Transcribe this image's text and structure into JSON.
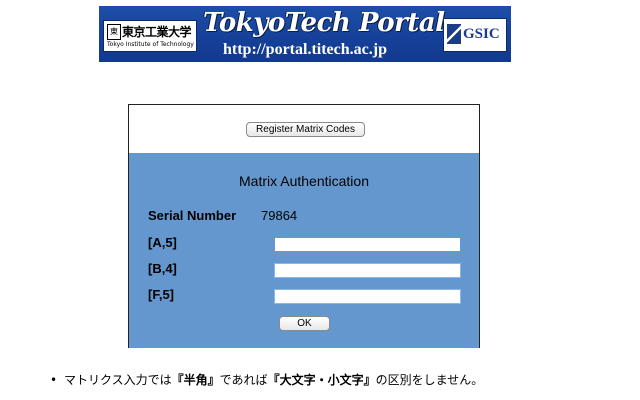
{
  "banner": {
    "logo_jp": "東京工業大学",
    "logo_en": "Tokyo Institute of Technology",
    "title": "TokyoTech Portal",
    "url": "http://portal.titech.ac.jp",
    "gsic": "GSIC"
  },
  "panel": {
    "register_button": "Register Matrix Codes",
    "title": "Matrix Authentication",
    "serial_label": "Serial Number",
    "serial_value": "79864",
    "fields": [
      {
        "label": "[A,5]",
        "value": ""
      },
      {
        "label": "[B,4]",
        "value": ""
      },
      {
        "label": "[F,5]",
        "value": ""
      }
    ],
    "ok_button": "OK"
  },
  "note": {
    "bullet": "•",
    "part1": "マトリクス入力では",
    "bold1": "『半角』",
    "part2": "であれば",
    "bold2": "『大文字・小文字』",
    "part3": "の区別をしません。"
  }
}
